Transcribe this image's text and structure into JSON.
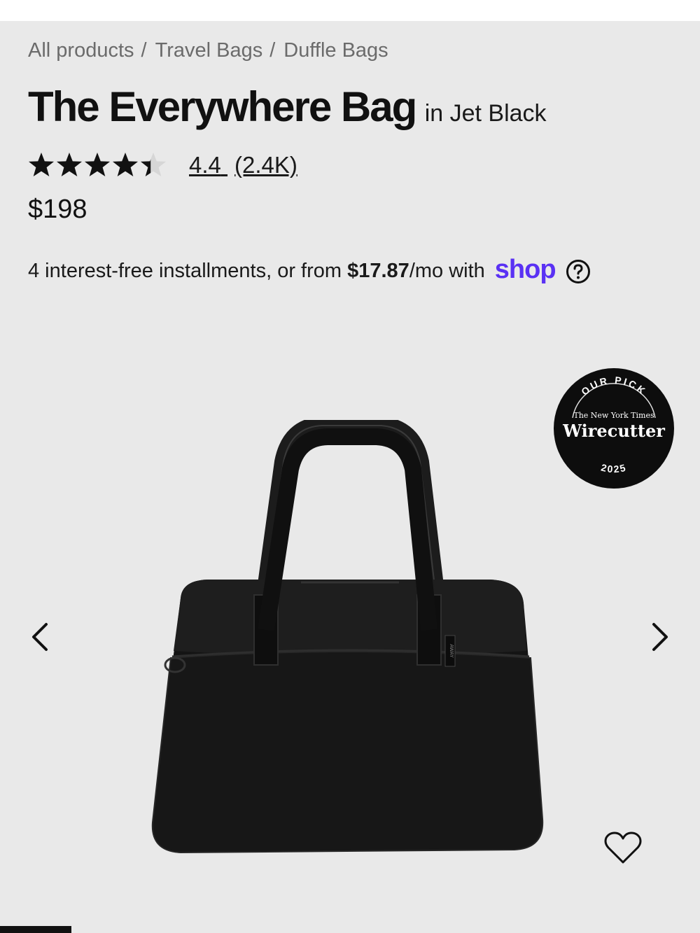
{
  "breadcrumb": {
    "items": [
      "All products",
      "Travel Bags",
      "Duffle Bags"
    ],
    "separator": "/"
  },
  "product": {
    "title": "The Everywhere Bag",
    "color_label": "in Jet Black",
    "rating": {
      "value": "4.4",
      "count": "(2.4K)",
      "stars_out_of_5": 4.4
    },
    "price": "$198"
  },
  "installments": {
    "prefix": "4 interest-free installments, or from",
    "amount": "$17.87",
    "suffix": "/mo with",
    "provider": "shop",
    "help_icon": "question-circle-icon"
  },
  "badge": {
    "top": "OUR PICK",
    "publisher": "The New York Times",
    "name": "Wirecutter",
    "year": "2025"
  },
  "bag_logo": "AWAY",
  "icons": {
    "prev": "chevron-left-icon",
    "next": "chevron-right-icon",
    "wishlist": "heart-outline-icon",
    "rating": "star-icon"
  },
  "colors": {
    "background": "#e9e9e9",
    "shop_brand": "#5a31f4",
    "text": "#1a1a1a"
  }
}
